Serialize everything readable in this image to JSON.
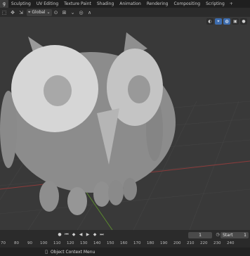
{
  "workspace_tabs": [
    "g",
    "Sculpting",
    "UV Editing",
    "Texture Paint",
    "Shading",
    "Animation",
    "Rendering",
    "Compositing",
    "Scripting"
  ],
  "active_tab_index": 0,
  "add_workspace_label": "+",
  "viewport_header": {
    "transform_orientation": "Global"
  },
  "timeline": {
    "current_frame": "1",
    "start_label": "Start",
    "start_value": "1",
    "ruler_ticks": [
      "70",
      "80",
      "90",
      "100",
      "110",
      "120",
      "130",
      "140",
      "150",
      "160",
      "170",
      "180",
      "190",
      "200",
      "210",
      "220",
      "230",
      "240"
    ]
  },
  "status_bar": {
    "context_menu_label": "Object Context Menu"
  },
  "icons": {
    "play": "play-icon",
    "jump_start": "jump-start-icon",
    "jump_end": "jump-end-icon",
    "keyframe_prev": "keyframe-prev-icon",
    "keyframe_next": "keyframe-next-icon",
    "clock": "clock-icon",
    "mouse": "mouse-icon"
  },
  "colors": {
    "viewport_bg": "#393939",
    "grid_red_axis": "#8c3b3b",
    "grid_green_axis": "#5b8a2e",
    "owl_grey": "#9a9a9a",
    "accent_blue": "#3d6cae"
  }
}
